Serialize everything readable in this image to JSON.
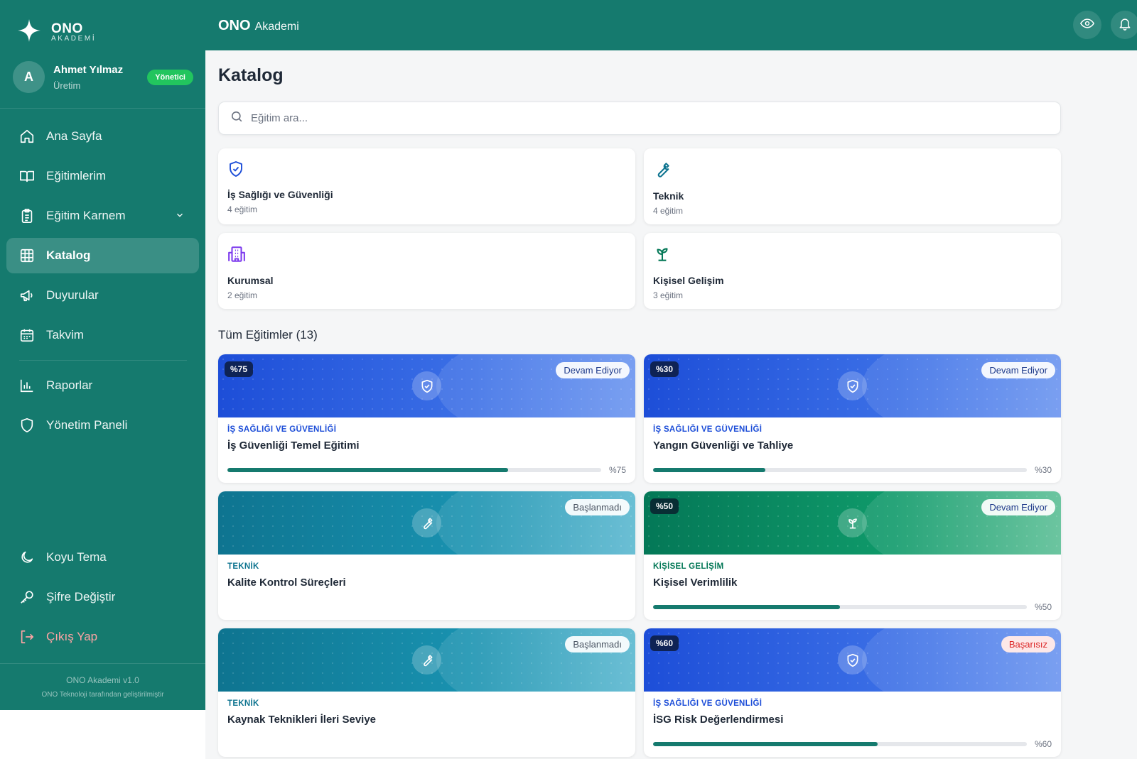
{
  "brand": {
    "name": "ONO",
    "sub": "AKADEMİ"
  },
  "user": {
    "initial": "A",
    "name": "Ahmet Yılmaz",
    "department": "Üretim",
    "role": "Yönetici"
  },
  "nav": {
    "home": "Ana Sayfa",
    "my_trainings": "Eğitimlerim",
    "report_card": "Eğitim Karnem",
    "catalog": "Katalog",
    "announcements": "Duyurular",
    "calendar": "Takvim",
    "reports": "Raporlar",
    "admin_panel": "Yönetim Paneli",
    "dark_theme": "Koyu Tema",
    "change_password": "Şifre Değiştir",
    "logout": "Çıkış Yap"
  },
  "footer": {
    "version": "ONO Akademi v1.0",
    "developer": "ONO Teknoloji tarafından geliştirilmiştir"
  },
  "header": {
    "brand_bold": "ONO",
    "brand_rest": "Akademi"
  },
  "page": {
    "title": "Katalog",
    "search_placeholder": "Eğitim ara..."
  },
  "categories": [
    {
      "name": "İş Sağlığı ve Güvenliği",
      "count": "4 eğitim",
      "icon": "shield-check-icon",
      "color": "#1d4ed8"
    },
    {
      "name": "Teknik",
      "count": "4 eğitim",
      "icon": "wrench-icon",
      "color": "#0e7490"
    },
    {
      "name": "Kurumsal",
      "count": "2 eğitim",
      "icon": "building-icon",
      "color": "#7c3aed"
    },
    {
      "name": "Kişisel Gelişim",
      "count": "3 eğitim",
      "icon": "sprout-icon",
      "color": "#047857"
    }
  ],
  "section_title": "Tüm Eğitimler (13)",
  "courses": [
    {
      "category": "İŞ SAĞLIĞI VE GÜVENLİĞİ",
      "title": "İş Güvenliği Temel Eğitimi",
      "status": "Devam Ediyor",
      "badge": "%75",
      "progress": 75,
      "progress_label": "%75"
    },
    {
      "category": "İŞ SAĞLIĞI VE GÜVENLİĞİ",
      "title": "Yangın Güvenliği ve Tahliye",
      "status": "Devam Ediyor",
      "badge": "%30",
      "progress": 30,
      "progress_label": "%30"
    },
    {
      "category": "TEKNİK",
      "title": "Kalite Kontrol Süreçleri",
      "status": "Başlanmadı"
    },
    {
      "category": "KİŞİSEL GELİŞİM",
      "title": "Kişisel Verimlilik",
      "status": "Devam Ediyor",
      "badge": "%50",
      "progress": 50,
      "progress_label": "%50"
    },
    {
      "category": "TEKNİK",
      "title": "Kaynak Teknikleri İleri Seviye",
      "status": "Başlanmadı"
    },
    {
      "category": "İŞ SAĞLIĞI VE GÜVENLİĞİ",
      "title": "İSG Risk Değerlendirmesi",
      "status": "Başarısız",
      "badge": "%60",
      "progress": 60,
      "progress_label": "%60"
    }
  ],
  "colors": {
    "primary": "#157a6e",
    "success": "#22c55e",
    "danger": "#dc2626"
  }
}
